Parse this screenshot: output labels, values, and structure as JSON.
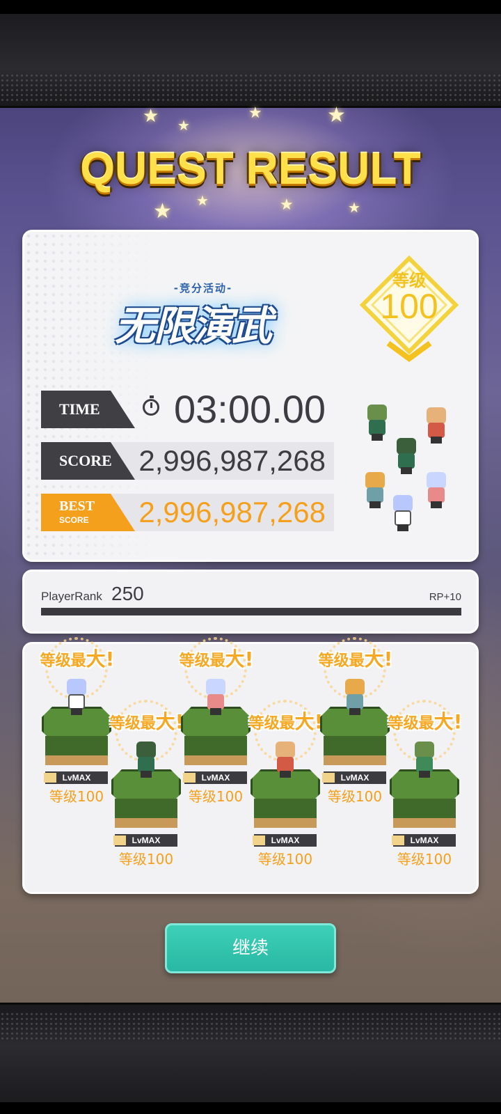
{
  "header": {
    "title": "QUEST RESULT"
  },
  "event": {
    "subtitle": "-竞分活动-",
    "title": "无限演武"
  },
  "level_badge": {
    "label": "等级",
    "value": "100"
  },
  "results": {
    "time_label": "TIME",
    "time_value": "03:00.00",
    "score_label": "SCORE",
    "score_value": "2,996,987,268",
    "best_label": "BEST",
    "best_sub": "SCORE",
    "best_value": "2,996,987,268"
  },
  "player_rank": {
    "label": "PlayerRank",
    "value": "250",
    "rp": "RP+10",
    "progress": 1.0
  },
  "units": [
    {
      "tag": "等级最",
      "tag_big": "大!",
      "lvmax": "LvMAX",
      "level": "等级100",
      "color": "#b9c7ff"
    },
    {
      "tag": "等级最",
      "tag_big": "大!",
      "lvmax": "LvMAX",
      "level": "等级100",
      "color": "#2f6e4f"
    },
    {
      "tag": "等级最",
      "tag_big": "大!",
      "lvmax": "LvMAX",
      "level": "等级100",
      "color": "#c9d6ff"
    },
    {
      "tag": "等级最",
      "tag_big": "大!",
      "lvmax": "LvMAX",
      "level": "等级100",
      "color": "#d35a44"
    },
    {
      "tag": "等级最",
      "tag_big": "大!",
      "lvmax": "LvMAX",
      "level": "等级100",
      "color": "#e7a94a"
    },
    {
      "tag": "等级最",
      "tag_big": "大!",
      "lvmax": "LvMAX",
      "level": "等级100",
      "color": "#3e8a58"
    }
  ],
  "continue_button": {
    "label": "继续"
  },
  "colors": {
    "accent_orange": "#f5a01d",
    "teal_button": "#2fc3ad",
    "level_gold": "#f4c21f"
  }
}
